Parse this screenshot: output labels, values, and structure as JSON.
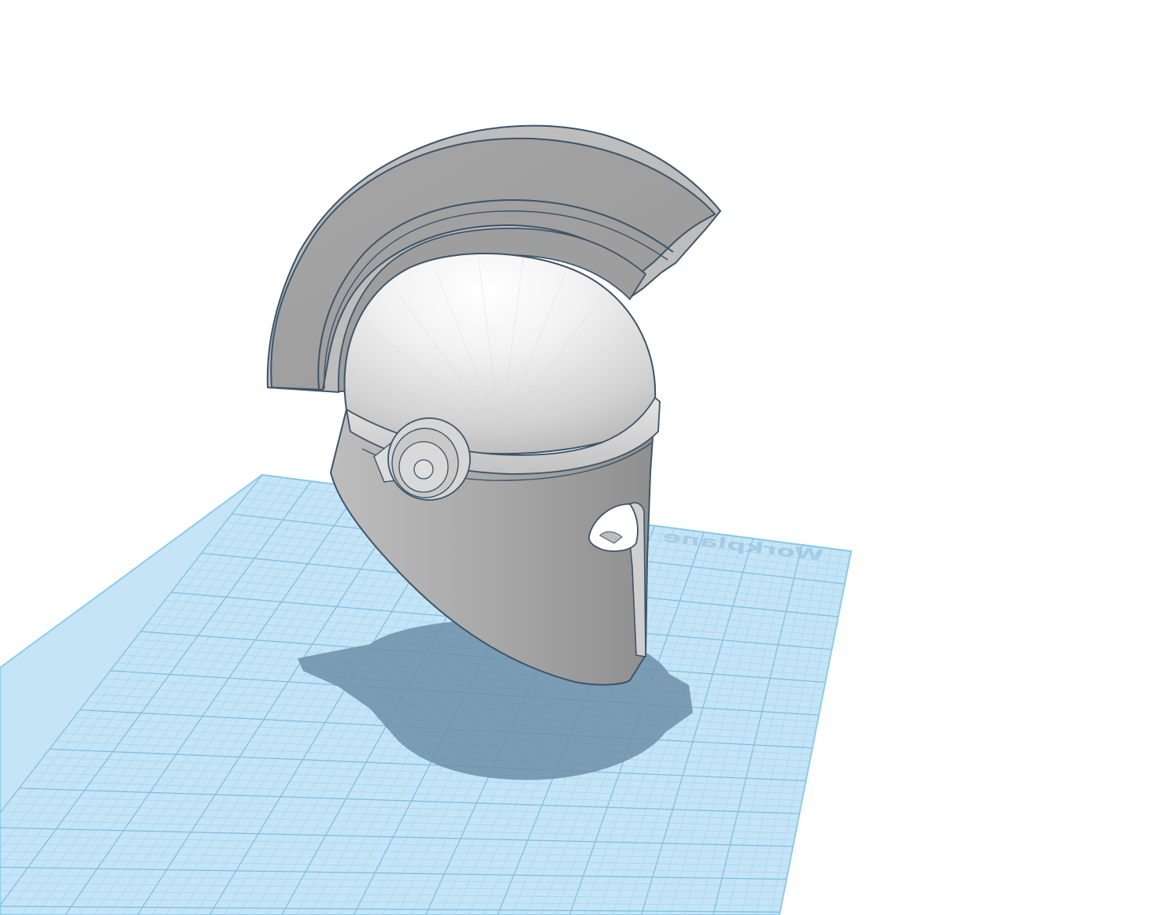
{
  "viewport": {
    "workplane_label": "Workplane",
    "model_name": "helmet",
    "workplane_color": "#c5e4f6",
    "grid_color": "#7fc1e3",
    "model_color": "#a4a4a4",
    "outline_color": "#3d5468",
    "shadow_color": "#6d8fa8",
    "background_color": "#ffffff"
  }
}
